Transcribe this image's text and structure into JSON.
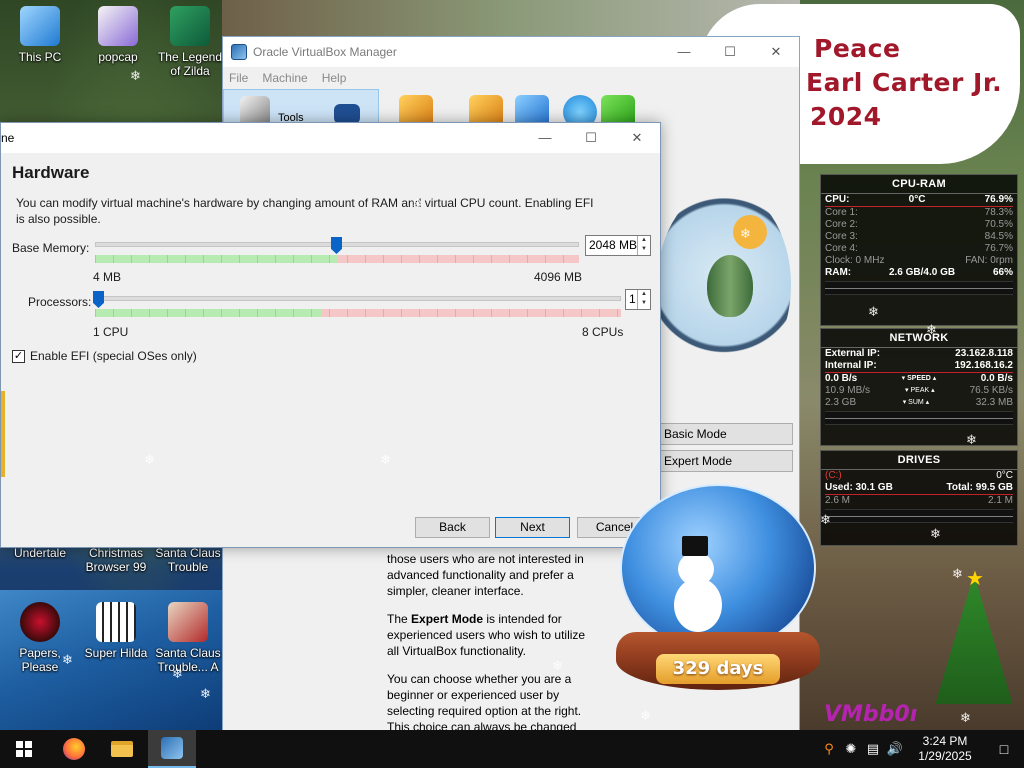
{
  "desktop": {
    "icons": [
      {
        "label": "This PC"
      },
      {
        "label": "popcap"
      },
      {
        "label": "The Legend of Zilda"
      },
      {
        "label": "Undertale"
      },
      {
        "label": "Christmas Browser 99"
      },
      {
        "label": "Santa Claus Trouble"
      },
      {
        "label": "Papers, Please"
      },
      {
        "label": "Super Hilda"
      },
      {
        "label": "Santa Claus Trouble... A"
      }
    ],
    "memorial": {
      "line1": "Peace",
      "line2": "Earl Carter Jr.",
      "line3": "2024"
    },
    "watermark": "VMbb0ı"
  },
  "vbox_manager": {
    "title": "Oracle VirtualBox Manager",
    "menu": [
      "File",
      "Machine",
      "Help"
    ],
    "tools_label": "Tools",
    "basic_mode": "Basic Mode",
    "expert_mode": "Expert Mode",
    "help_p1": "those users who are not interested in advanced functionality and prefer a simpler, cleaner interface.",
    "help_p2_pre": "The ",
    "help_p2_bold": "Expert Mode",
    "help_p2_post": " is intended for experienced users who wish to utilize all VirtualBox functionality.",
    "help_p3": "You can choose whether you are a beginner or experienced user by selecting required option at the right. This choice can always be changed in Global Preferences or Machine Settings windows."
  },
  "dialog": {
    "title_fragment": "ne",
    "heading": "Hardware",
    "description": "You can modify virtual machine's hardware by changing amount of RAM and virtual CPU count. Enabling EFI is also possible.",
    "memory": {
      "label": "Base Memory:",
      "value": "2048 MB",
      "min_label": "4 MB",
      "max_label": "4096 MB",
      "fraction": 0.5,
      "recommended_fraction": 0.5
    },
    "processors": {
      "label": "Processors:",
      "value": "1",
      "min_label": "1 CPU",
      "max_label": "8 CPUs",
      "fraction": 0.0,
      "recommended_fraction": 0.43
    },
    "efi": {
      "label": "Enable EFI (special OSes only)",
      "checked": true,
      "check_mark": "✓"
    },
    "buttons": {
      "back": "Back",
      "next": "Next",
      "cancel": "Cancel"
    },
    "win_minimize": "—",
    "win_maximize": "☐",
    "win_close": "✕"
  },
  "cpu_ram": {
    "title": "CPU-RAM",
    "cpu_label": "CPU:",
    "cpu_temp": "0°C",
    "cpu_value": "76.9%",
    "cores": [
      {
        "label": "Core 1:",
        "value": "78.3%"
      },
      {
        "label": "Core 2:",
        "value": "70.5%"
      },
      {
        "label": "Core 3:",
        "value": "84.5%"
      },
      {
        "label": "Core 4:",
        "value": "76.7%"
      }
    ],
    "clock_label": "Clock: 0 MHz",
    "fan_label": "FAN: 0rpm",
    "ram_label": "RAM:",
    "ram_usage": "2.6 GB/4.0 GB",
    "ram_percent": "66%"
  },
  "network": {
    "title": "NETWORK",
    "external_label": "External IP:",
    "external_ip": "23.162.8.118",
    "internal_label": "Internal IP:",
    "internal_ip": "192.168.16.2",
    "speed_down": "0.0 B/s",
    "speed_label": "▾ SPEED ▴",
    "speed_up": "0.0 B/s",
    "peak_down": "10.9 MB/s",
    "peak_label": "▾ PEAK ▴",
    "peak_up": "76.5 KB/s",
    "sum_down": "2.3 GB",
    "sum_label": "▾ SUM ▴",
    "sum_up": "32.3 MB"
  },
  "drives": {
    "title": "DRIVES",
    "drive_letter": "(C:)",
    "temp": "0°C",
    "used_label": "Used: 30.1 GB",
    "total_label": "Total: 99.5 GB",
    "read": "2.6 M",
    "write": "2.1 M"
  },
  "snowglobe": {
    "days": "329 days"
  },
  "taskbar": {
    "time": "3:24 PM",
    "date": "1/29/2025"
  }
}
